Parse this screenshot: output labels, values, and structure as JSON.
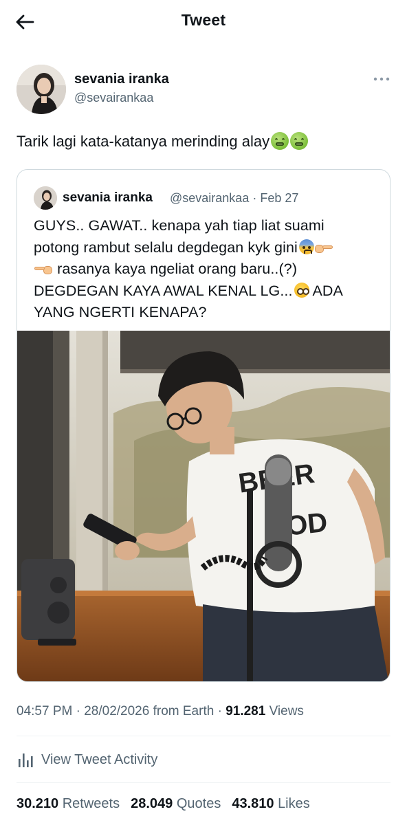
{
  "header": {
    "title": "Tweet",
    "back_icon": "arrow-left-icon"
  },
  "author": {
    "name": "sevania iranka",
    "handle": "@sevairankaa",
    "more_icon": "more-horizontal-icon"
  },
  "tweet": {
    "text": "Tarik lagi kata-katanya merinding alay",
    "emojis": [
      "nauseated-face-icon",
      "nauseated-face-icon"
    ]
  },
  "quote": {
    "name": "sevania iranka",
    "meta": "@sevairankaa · Feb 27",
    "line1": "GUYS.. GAWAT.. kenapa yah tiap liat suami",
    "line2": "potong rambut selalu degdegan kyk gini",
    "line3": "rasanya kaya ngeliat orang baru..(?)",
    "line4": "DEGDEGAN KAYA AWAL KENAL LG...",
    "line4_end": "ADA",
    "line5": "YANG NGERTI KENAPA?",
    "photo_text": "BEER OD"
  },
  "details": {
    "time": "04:57 PM",
    "date": "28/02/2026",
    "source": "from Earth",
    "views_count": "91.281",
    "views_label": "Views"
  },
  "activity": {
    "label": "View Tweet Activity",
    "icon": "bar-chart-icon"
  },
  "stats": {
    "retweets_count": "30.210",
    "retweets_label": "Retweets",
    "quotes_count": "28.049",
    "quotes_label": "Quotes",
    "likes_count": "43.810",
    "likes_label": "Likes"
  },
  "colors": {
    "text": "#0f1419",
    "secondary": "#536471",
    "border": "#cfd9de"
  }
}
